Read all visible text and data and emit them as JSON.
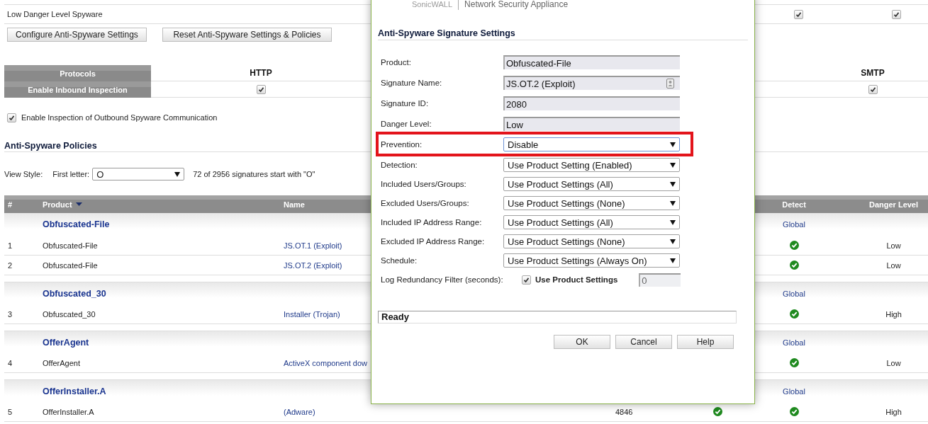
{
  "top_row": {
    "label": "Low Danger Level Spyware",
    "checks": [
      {
        "checked": true
      },
      {
        "checked": true
      }
    ]
  },
  "actions": [
    "Configure Anti-Spyware Settings",
    "Reset Anti-Spyware Settings & Policies"
  ],
  "protocols": {
    "header": "Protocols",
    "row_label": "Enable Inbound Inspection",
    "columns": [
      {
        "label": "HTTP",
        "checked": true
      },
      {
        "label": "SMTP",
        "checked": true
      }
    ]
  },
  "outbound": {
    "label": "Enable Inspection of Outbound Spyware Communication",
    "checked": true
  },
  "policies": {
    "title": "Anti-Spyware Policies",
    "view_style_label": "View Style:",
    "first_letter_label": "First letter:",
    "first_letter": "O",
    "count_text": "72 of 2956 signatures start with \"O\"",
    "table": {
      "columns": [
        {
          "kind": "number",
          "label": "#",
          "sorted": false
        },
        {
          "kind": "product",
          "label": "Product",
          "sorted": true
        },
        {
          "kind": "name",
          "label": "Name",
          "sorted": false
        },
        {
          "kind": "detect",
          "label": "Detect",
          "sorted": false
        },
        {
          "kind": "danger_level",
          "label": "Danger Level",
          "sorted": false
        }
      ],
      "groups": [
        {
          "product": "Obfuscated-File",
          "detect": "Global",
          "rows": [
            {
              "number": "1",
              "product": "Obfuscated-File",
              "name": "JS.OT.1 (Exploit)",
              "detect": true,
              "danger_level": "Low"
            },
            {
              "number": "2",
              "product": "Obfuscated-File",
              "name": "JS.OT.2 (Exploit)",
              "detect": true,
              "danger_level": "Low"
            }
          ]
        },
        {
          "product": "Obfuscated_30",
          "detect": "Global",
          "rows": [
            {
              "number": "3",
              "product": "Obfuscated_30",
              "name": "Installer (Trojan)",
              "detect": true,
              "danger_level": "High"
            }
          ]
        },
        {
          "product": "OfferAgent",
          "detect": "Global",
          "rows": [
            {
              "number": "4",
              "product": "OfferAgent",
              "name": "ActiveX component dow",
              "detect": true,
              "danger_level": "Low"
            }
          ]
        },
        {
          "product": "OfferInstaller.A",
          "detect": "Global",
          "rows": [
            {
              "number": "5",
              "product": "OfferInstaller.A",
              "name": "(Adware)",
              "column_4": "4846",
              "column_5": true,
              "detect": true,
              "danger_level": "High"
            }
          ]
        }
      ]
    }
  },
  "dialog": {
    "brand": "SonicWALL",
    "product_line": "Network Security Appliance",
    "title": "Anti-Spyware Signature Settings",
    "fields": [
      {
        "kind": "text",
        "label": "Product:",
        "value": "Obfuscated-File"
      },
      {
        "kind": "text",
        "label": "Signature Name:",
        "value": "JS.OT.2 (Exploit)",
        "card_button": true
      },
      {
        "kind": "text",
        "label": "Signature ID:",
        "value": "2080"
      },
      {
        "kind": "text",
        "label": "Danger Level:",
        "value": "Low"
      },
      {
        "kind": "select",
        "label": "Prevention:",
        "value": "Disable",
        "focused": true,
        "highlighted": true
      },
      {
        "kind": "select",
        "label": "Detection:",
        "value": "Use Product Setting (Enabled)",
        "focused": false,
        "highlighted": false
      },
      {
        "kind": "select",
        "label": "Included Users/Groups:",
        "value": "Use Product Settings (All)",
        "focused": false,
        "highlighted": false
      },
      {
        "kind": "select",
        "label": "Excluded Users/Groups:",
        "value": "Use Product Settings (None)",
        "focused": false,
        "highlighted": false
      },
      {
        "kind": "select",
        "label": "Included IP Address Range:",
        "value": "Use Product Settings (All)",
        "focused": false,
        "highlighted": false
      },
      {
        "kind": "select",
        "label": "Excluded IP Address Range:",
        "value": "Use Product Settings (None)",
        "focused": false,
        "highlighted": false
      },
      {
        "kind": "select",
        "label": "Schedule:",
        "value": "Use Product Settings (Always On)",
        "focused": false,
        "highlighted": false
      },
      {
        "kind": "check_number",
        "label": "Log Redundancy Filter (seconds):",
        "checked": true,
        "check_label": "Use Product Settings",
        "value": "0"
      }
    ],
    "status": "Ready",
    "buttons": [
      "OK",
      "Cancel",
      "Help"
    ]
  }
}
